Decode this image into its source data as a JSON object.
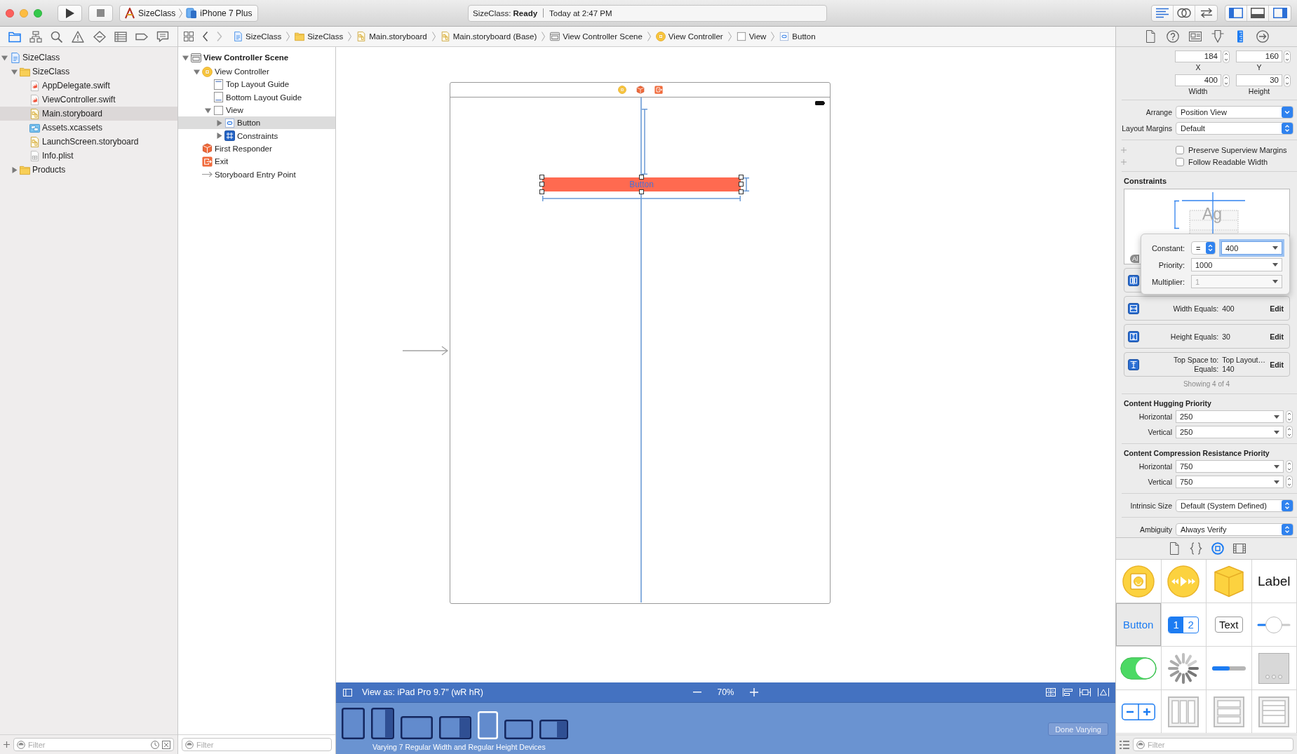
{
  "toolbar": {
    "scheme": "SizeClass",
    "destination": "iPhone 7 Plus",
    "status": "SizeClass: **Ready**",
    "time": "Today at 2:47 PM",
    "editor_modes": [
      {
        "kind": "standard",
        "selected": true
      },
      {
        "kind": "assistant",
        "selected": false
      },
      {
        "kind": "version",
        "selected": false
      }
    ],
    "panels": [
      {
        "kind": "navigator",
        "on": true
      },
      {
        "kind": "debug",
        "on": false
      },
      {
        "kind": "utilities",
        "on": true
      }
    ]
  },
  "navigator": {
    "tabs": [
      {
        "kind": "project",
        "selected": true
      },
      {
        "kind": "symbol",
        "selected": false
      },
      {
        "kind": "find",
        "selected": false
      },
      {
        "kind": "issue",
        "selected": false
      },
      {
        "kind": "test",
        "selected": false
      },
      {
        "kind": "debug",
        "selected": false
      },
      {
        "kind": "breakpoint",
        "selected": false
      },
      {
        "kind": "report",
        "selected": false
      }
    ],
    "tree": [
      {
        "label": "SizeClass",
        "kind": "project",
        "expanded": true,
        "selected": false,
        "children": [
          {
            "label": "SizeClass",
            "kind": "folder",
            "expanded": true,
            "selected": false,
            "children": [
              {
                "label": "AppDelegate.swift",
                "kind": "swift",
                "selected": false
              },
              {
                "label": "ViewController.swift",
                "kind": "swift",
                "selected": false
              },
              {
                "label": "Main.storyboard",
                "kind": "storyboard",
                "selected": true
              },
              {
                "label": "Assets.xcassets",
                "kind": "assets",
                "selected": false
              },
              {
                "label": "LaunchScreen.storyboard",
                "kind": "storyboard",
                "selected": false
              },
              {
                "label": "Info.plist",
                "kind": "plist",
                "selected": false
              }
            ]
          },
          {
            "label": "Products",
            "kind": "folder",
            "expanded": false,
            "selected": false
          }
        ]
      }
    ],
    "filter": {
      "placeholder": "Filter"
    }
  },
  "jump_bar": {
    "nav_buttons": [
      {
        "kind": "back",
        "disabled": false
      },
      {
        "kind": "forward",
        "disabled": true
      }
    ],
    "items": [
      {
        "label": "SizeClass",
        "kind": "project"
      },
      {
        "label": "SizeClass",
        "kind": "folder"
      },
      {
        "label": "Main.storyboard",
        "kind": "storyboard"
      },
      {
        "label": "Main.storyboard (Base)",
        "kind": "storyboard"
      },
      {
        "label": "View Controller Scene",
        "kind": "scene"
      },
      {
        "label": "View Controller",
        "kind": "view_controller"
      },
      {
        "label": "View",
        "kind": "view"
      },
      {
        "label": "Button",
        "kind": "button"
      }
    ]
  },
  "outline": {
    "tree": [
      {
        "label": "View Controller Scene",
        "kind": "scene",
        "expanded": true,
        "selected": false,
        "children": [
          {
            "label": "View Controller",
            "kind": "view_controller",
            "expanded": true,
            "selected": false,
            "children": [
              {
                "label": "Top Layout Guide",
                "kind": "layout_guide_top",
                "selected": false
              },
              {
                "label": "Bottom Layout Guide",
                "kind": "layout_guide_bottom",
                "selected": false
              },
              {
                "label": "View",
                "kind": "view",
                "expanded": true,
                "selected": false,
                "children": [
                  {
                    "label": "Button",
                    "kind": "button",
                    "expanded": false,
                    "selected": true
                  },
                  {
                    "label": "Constraints",
                    "kind": "constraints",
                    "expanded": false,
                    "selected": false
                  }
                ]
              }
            ]
          },
          {
            "label": "First Responder",
            "kind": "first_responder",
            "selected": false
          },
          {
            "label": "Exit",
            "kind": "exit",
            "selected": false
          },
          {
            "label": "Storyboard Entry Point",
            "kind": "entry_point",
            "selected": false
          }
        ]
      }
    ],
    "filter": {
      "placeholder": "Filter"
    }
  },
  "canvas": {
    "button_title": "Button",
    "view_as": "View as: iPad Pro 9.7″ (wR hR)",
    "zoom": "70%",
    "devices": [
      {
        "kind": "portrait",
        "split": false,
        "selected": false
      },
      {
        "kind": "portrait",
        "split": true,
        "selected": false
      },
      {
        "kind": "landscape",
        "split": false,
        "selected": false
      },
      {
        "kind": "landscape",
        "split": true,
        "selected": false
      },
      {
        "kind": "portrait_small",
        "split": false,
        "selected": true
      },
      {
        "kind": "landscape_small",
        "split": false,
        "selected": false
      },
      {
        "kind": "landscape_small",
        "split": true,
        "selected": false
      }
    ],
    "varying": "Varying 7 Regular Width and Regular Height Devices",
    "done_button": "Done Varying"
  },
  "inspector": {
    "tabs": [
      {
        "kind": "file",
        "selected": false
      },
      {
        "kind": "help",
        "selected": false
      },
      {
        "kind": "identity",
        "selected": false
      },
      {
        "kind": "attributes",
        "selected": false
      },
      {
        "kind": "size",
        "selected": true
      },
      {
        "kind": "connections",
        "selected": false
      }
    ],
    "geometry": [
      {
        "value": "184",
        "label": "X"
      },
      {
        "value": "160",
        "label": "Y"
      },
      {
        "value": "400",
        "label": "Width"
      },
      {
        "value": "30",
        "label": "Height"
      }
    ],
    "layout_popups": [
      {
        "label": "Arrange",
        "value": "Position View",
        "kind": "pulldown"
      },
      {
        "label": "Layout Margins",
        "value": "Default",
        "kind": "popup"
      }
    ],
    "margin_options": [
      {
        "label": "Preserve Superview Margins",
        "checked": false
      },
      {
        "label": "Follow Readable Width",
        "checked": false
      }
    ],
    "constraints_title": "Constraints",
    "preview": {
      "sample": "Ag",
      "badge": "Al"
    },
    "popover": [
      {
        "label": "Constant:",
        "relation": "=",
        "value": "400",
        "focused": true,
        "disabled": false
      },
      {
        "label": "Priority:",
        "value": "1000",
        "focused": false,
        "disabled": false
      },
      {
        "label": "Multiplier:",
        "value": "1",
        "focused": false,
        "disabled": true
      }
    ],
    "constraints": [
      {
        "kind": "center_x"
      },
      {
        "kind": "width",
        "lines": [
          {
            "label": "Width Equals:",
            "value": "400"
          }
        ],
        "action": "Edit"
      },
      {
        "kind": "height",
        "lines": [
          {
            "label": "Height Equals:",
            "value": "30"
          }
        ],
        "action": "Edit"
      },
      {
        "kind": "top_space",
        "lines": [
          {
            "label": "Top Space to:",
            "value": "Top Layout…"
          },
          {
            "label": "Equals:",
            "value": "140"
          }
        ],
        "action": "Edit"
      }
    ],
    "showing": "Showing 4 of 4",
    "priorities": [
      {
        "title": "Content Hugging Priority",
        "rows": [
          {
            "label": "Horizontal",
            "value": "250"
          },
          {
            "label": "Vertical",
            "value": "250"
          }
        ]
      },
      {
        "title": "Content Compression Resistance Priority",
        "rows": [
          {
            "label": "Horizontal",
            "value": "750"
          },
          {
            "label": "Vertical",
            "value": "750"
          }
        ]
      }
    ],
    "bottom_popups": [
      {
        "label": "Intrinsic Size",
        "value": "Default (System Defined)",
        "kind": "popup"
      },
      {
        "label": "Ambiguity",
        "value": "Always Verify",
        "kind": "popup"
      }
    ]
  },
  "library": {
    "tabs": [
      {
        "kind": "file",
        "selected": false
      },
      {
        "kind": "code",
        "selected": false
      },
      {
        "kind": "object",
        "selected": true
      },
      {
        "kind": "media",
        "selected": false
      }
    ],
    "items": [
      {
        "kind": "view_controller",
        "selected": false
      },
      {
        "kind": "av_player",
        "selected": false
      },
      {
        "kind": "object",
        "selected": false
      },
      {
        "kind": "label",
        "text": "Label",
        "selected": false
      },
      {
        "kind": "button",
        "text": "Button",
        "selected": true
      },
      {
        "kind": "segmented",
        "segments": [
          {
            "label": "1",
            "selected": true
          },
          {
            "label": "2",
            "selected": false
          }
        ],
        "selected": false
      },
      {
        "kind": "text_field",
        "text": "Text",
        "selected": false
      },
      {
        "kind": "slider",
        "selected": false
      },
      {
        "kind": "switch",
        "selected": false
      },
      {
        "kind": "activity_indicator",
        "selected": false
      },
      {
        "kind": "progress",
        "selected": false
      },
      {
        "kind": "page_control",
        "selected": false
      },
      {
        "kind": "stepper",
        "selected": false
      },
      {
        "kind": "horizontal_stack",
        "selected": false
      },
      {
        "kind": "vertical_stack",
        "selected": false
      },
      {
        "kind": "table_view",
        "selected": false
      }
    ],
    "filter": {
      "placeholder": "Filter"
    }
  }
}
